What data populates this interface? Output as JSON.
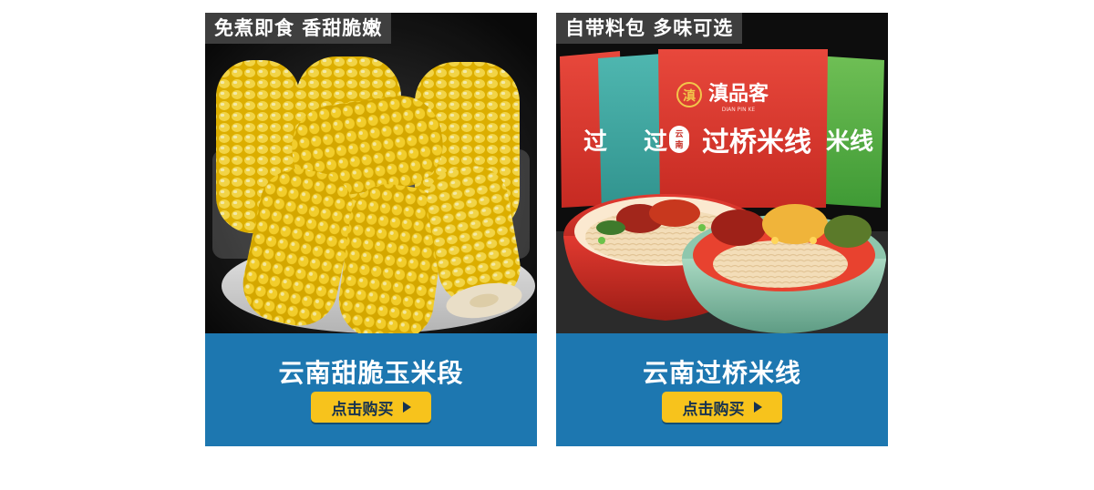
{
  "products": [
    {
      "tag": "免煮即食 香甜脆嫩",
      "title": "云南甜脆玉米段",
      "button_label": "点击购买"
    },
    {
      "tag": "自带料包 多味可选",
      "title": "云南过桥米线",
      "button_label": "点击购买",
      "package": {
        "brand": "滇品客",
        "brand_pinyin": "DIAN PIN KE",
        "badge": "云南",
        "name": "过桥米线"
      }
    }
  ],
  "colors": {
    "info_bar": "#1d77b0",
    "button": "#f7c31c",
    "tag_bg": "#464646"
  }
}
